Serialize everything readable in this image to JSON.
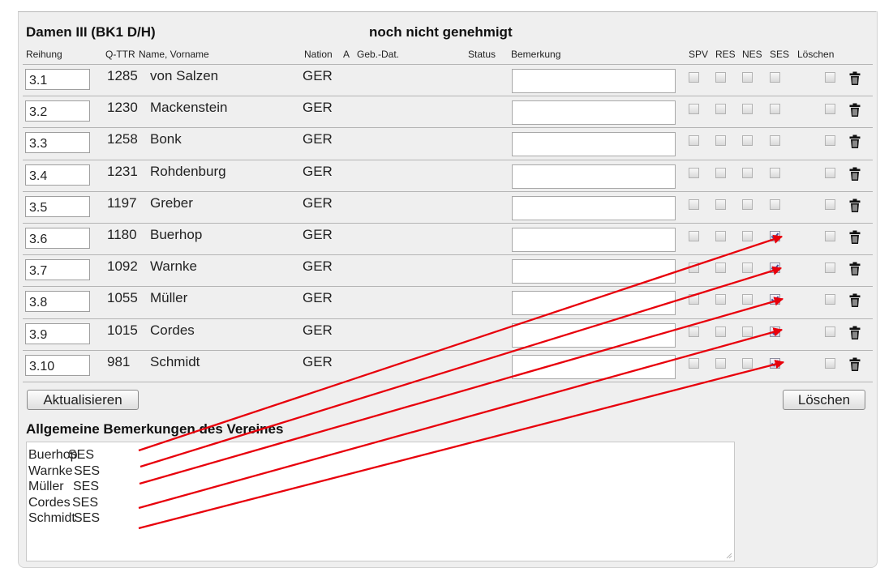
{
  "group": {
    "title": "Damen III (BK1 D/H)",
    "status": "noch nicht genehmigt"
  },
  "columns": {
    "reihung": "Reihung",
    "qttr": "Q-TTR",
    "name": "Name, Vorname",
    "nation": "Nation",
    "a": "A",
    "gebdat": "Geb.-Dat.",
    "status": "Status",
    "bemerkung": "Bemerkung",
    "spv": "SPV",
    "res": "RES",
    "nes": "NES",
    "ses": "SES",
    "loeschen": "Löschen"
  },
  "players": [
    {
      "reihung": "3.1",
      "qttr": "1285",
      "name": "von Salzen",
      "nation": "GER",
      "spv": false,
      "res": false,
      "nes": false,
      "ses": false,
      "loeschen": false
    },
    {
      "reihung": "3.2",
      "qttr": "1230",
      "name": "Mackenstein",
      "nation": "GER",
      "spv": false,
      "res": false,
      "nes": false,
      "ses": false,
      "loeschen": false
    },
    {
      "reihung": "3.3",
      "qttr": "1258",
      "name": "Bonk",
      "nation": "GER",
      "spv": false,
      "res": false,
      "nes": false,
      "ses": false,
      "loeschen": false
    },
    {
      "reihung": "3.4",
      "qttr": "1231",
      "name": "Rohdenburg",
      "nation": "GER",
      "spv": false,
      "res": false,
      "nes": false,
      "ses": false,
      "loeschen": false
    },
    {
      "reihung": "3.5",
      "qttr": "1197",
      "name": "Greber",
      "nation": "GER",
      "spv": false,
      "res": false,
      "nes": false,
      "ses": false,
      "loeschen": false
    },
    {
      "reihung": "3.6",
      "qttr": "1180",
      "name": "Buerhop",
      "nation": "GER",
      "spv": false,
      "res": false,
      "nes": false,
      "ses": true,
      "loeschen": false
    },
    {
      "reihung": "3.7",
      "qttr": "1092",
      "name": "Warnke",
      "nation": "GER",
      "spv": false,
      "res": false,
      "nes": false,
      "ses": true,
      "loeschen": false
    },
    {
      "reihung": "3.8",
      "qttr": "1055",
      "name": "Müller",
      "nation": "GER",
      "spv": false,
      "res": false,
      "nes": false,
      "ses": true,
      "loeschen": false
    },
    {
      "reihung": "3.9",
      "qttr": "1015",
      "name": "Cordes",
      "nation": "GER",
      "spv": false,
      "res": false,
      "nes": false,
      "ses": true,
      "loeschen": false
    },
    {
      "reihung": "3.10",
      "qttr": "981",
      "name": "Schmidt",
      "nation": "GER",
      "spv": false,
      "res": false,
      "nes": false,
      "ses": true,
      "loeschen": false
    }
  ],
  "buttons": {
    "update": "Aktualisieren",
    "delete": "Löschen"
  },
  "remarks": {
    "title": "Allgemeine Bemerkungen des Vereines",
    "lines": [
      {
        "name": "Buerhop",
        "code": "SES"
      },
      {
        "name": "Warnke",
        "code": "SES"
      },
      {
        "name": "Müller",
        "code": "SES"
      },
      {
        "name": "Cordes",
        "code": "SES"
      },
      {
        "name": "Schmidt",
        "code": "SES"
      }
    ]
  },
  "annotation": {
    "arrow_color": "#e8000b"
  },
  "icons": {
    "delete": "trash-icon",
    "checkbox": "checkbox",
    "resize": "resize-grip-icon"
  }
}
